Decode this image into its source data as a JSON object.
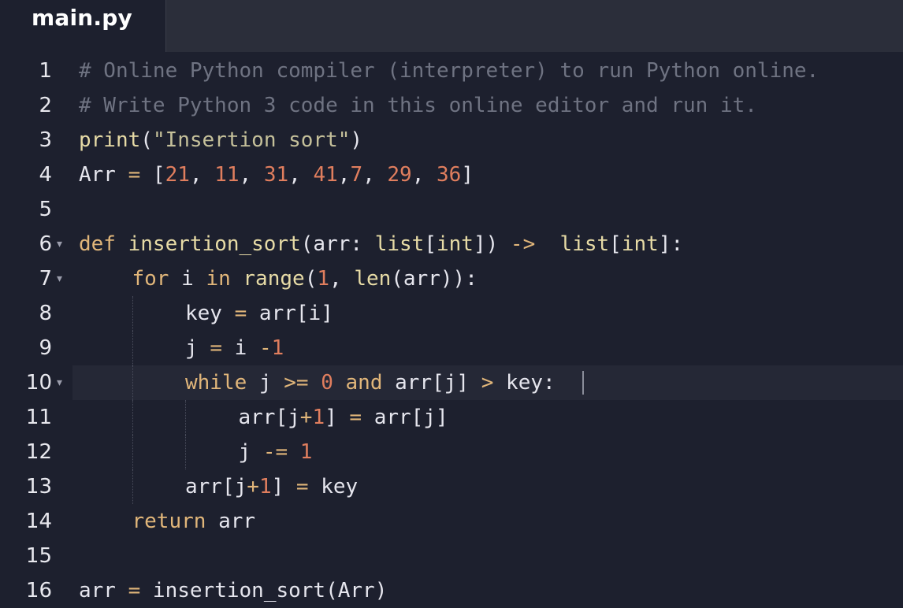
{
  "tab": {
    "label": "main.py"
  },
  "colors": {
    "background": "#1d202e",
    "tabbar": "#2b2e3a",
    "comment": "#6f7382",
    "keyword": "#e1b67a",
    "function": "#e7dba6",
    "string": "#c5c09a",
    "number": "#e07e5e",
    "text": "#e6e6ee"
  },
  "lines": [
    {
      "n": "1",
      "fold": false,
      "active": false,
      "indent": 0,
      "tokens": [
        {
          "t": "# Online Python compiler (interpreter) to run Python online.",
          "c": "comment"
        }
      ]
    },
    {
      "n": "2",
      "fold": false,
      "active": false,
      "indent": 0,
      "tokens": [
        {
          "t": "# Write Python 3 code in this online editor and run it.",
          "c": "comment"
        }
      ]
    },
    {
      "n": "3",
      "fold": false,
      "active": false,
      "indent": 0,
      "tokens": [
        {
          "t": "print",
          "c": "fn"
        },
        {
          "t": "(",
          "c": "plain"
        },
        {
          "t": "\"Insertion sort\"",
          "c": "str"
        },
        {
          "t": ")",
          "c": "plain"
        }
      ]
    },
    {
      "n": "4",
      "fold": false,
      "active": false,
      "indent": 0,
      "tokens": [
        {
          "t": "Arr ",
          "c": "plain"
        },
        {
          "t": "=",
          "c": "op"
        },
        {
          "t": " [",
          "c": "plain"
        },
        {
          "t": "21",
          "c": "num"
        },
        {
          "t": ", ",
          "c": "plain"
        },
        {
          "t": "11",
          "c": "num"
        },
        {
          "t": ", ",
          "c": "plain"
        },
        {
          "t": "31",
          "c": "num"
        },
        {
          "t": ", ",
          "c": "plain"
        },
        {
          "t": "41",
          "c": "num"
        },
        {
          "t": ",",
          "c": "plain"
        },
        {
          "t": "7",
          "c": "num"
        },
        {
          "t": ", ",
          "c": "plain"
        },
        {
          "t": "29",
          "c": "num"
        },
        {
          "t": ", ",
          "c": "plain"
        },
        {
          "t": "36",
          "c": "num"
        },
        {
          "t": "]",
          "c": "plain"
        }
      ]
    },
    {
      "n": "5",
      "fold": false,
      "active": false,
      "indent": 0,
      "tokens": []
    },
    {
      "n": "6",
      "fold": true,
      "active": false,
      "indent": 0,
      "tokens": [
        {
          "t": "def",
          "c": "kw"
        },
        {
          "t": " ",
          "c": "plain"
        },
        {
          "t": "insertion_sort",
          "c": "fn"
        },
        {
          "t": "(arr: ",
          "c": "plain"
        },
        {
          "t": "list",
          "c": "fn"
        },
        {
          "t": "[",
          "c": "plain"
        },
        {
          "t": "int",
          "c": "fn"
        },
        {
          "t": "]) ",
          "c": "plain"
        },
        {
          "t": "->",
          "c": "op"
        },
        {
          "t": "  ",
          "c": "plain"
        },
        {
          "t": "list",
          "c": "fn"
        },
        {
          "t": "[",
          "c": "plain"
        },
        {
          "t": "int",
          "c": "fn"
        },
        {
          "t": "]:",
          "c": "plain"
        }
      ]
    },
    {
      "n": "7",
      "fold": true,
      "active": false,
      "indent": 1,
      "tokens": [
        {
          "t": "for",
          "c": "kw"
        },
        {
          "t": " i ",
          "c": "plain"
        },
        {
          "t": "in",
          "c": "kw"
        },
        {
          "t": " ",
          "c": "plain"
        },
        {
          "t": "range",
          "c": "fn"
        },
        {
          "t": "(",
          "c": "plain"
        },
        {
          "t": "1",
          "c": "num"
        },
        {
          "t": ", ",
          "c": "plain"
        },
        {
          "t": "len",
          "c": "fn"
        },
        {
          "t": "(arr)):",
          "c": "plain"
        }
      ]
    },
    {
      "n": "8",
      "fold": false,
      "active": false,
      "indent": 2,
      "tokens": [
        {
          "t": "key ",
          "c": "plain"
        },
        {
          "t": "=",
          "c": "op"
        },
        {
          "t": " arr[i]",
          "c": "plain"
        }
      ]
    },
    {
      "n": "9",
      "fold": false,
      "active": false,
      "indent": 2,
      "tokens": [
        {
          "t": "j ",
          "c": "plain"
        },
        {
          "t": "=",
          "c": "op"
        },
        {
          "t": " i ",
          "c": "plain"
        },
        {
          "t": "-",
          "c": "op"
        },
        {
          "t": "1",
          "c": "num"
        }
      ]
    },
    {
      "n": "10",
      "fold": true,
      "active": true,
      "indent": 2,
      "tokens": [
        {
          "t": "while",
          "c": "kw"
        },
        {
          "t": " j ",
          "c": "plain"
        },
        {
          "t": ">=",
          "c": "op"
        },
        {
          "t": " ",
          "c": "plain"
        },
        {
          "t": "0",
          "c": "num"
        },
        {
          "t": " ",
          "c": "plain"
        },
        {
          "t": "and",
          "c": "kw"
        },
        {
          "t": " arr[j] ",
          "c": "plain"
        },
        {
          "t": ">",
          "c": "op"
        },
        {
          "t": " key:",
          "c": "plain"
        }
      ]
    },
    {
      "n": "11",
      "fold": false,
      "active": false,
      "indent": 3,
      "tokens": [
        {
          "t": "arr[j",
          "c": "plain"
        },
        {
          "t": "+",
          "c": "op"
        },
        {
          "t": "1",
          "c": "num"
        },
        {
          "t": "] ",
          "c": "plain"
        },
        {
          "t": "=",
          "c": "op"
        },
        {
          "t": " arr[j]",
          "c": "plain"
        }
      ]
    },
    {
      "n": "12",
      "fold": false,
      "active": false,
      "indent": 3,
      "tokens": [
        {
          "t": "j ",
          "c": "plain"
        },
        {
          "t": "-=",
          "c": "op"
        },
        {
          "t": " ",
          "c": "plain"
        },
        {
          "t": "1",
          "c": "num"
        }
      ]
    },
    {
      "n": "13",
      "fold": false,
      "active": false,
      "indent": 2,
      "tokens": [
        {
          "t": "arr[j",
          "c": "plain"
        },
        {
          "t": "+",
          "c": "op"
        },
        {
          "t": "1",
          "c": "num"
        },
        {
          "t": "] ",
          "c": "plain"
        },
        {
          "t": "=",
          "c": "op"
        },
        {
          "t": " key",
          "c": "plain"
        }
      ]
    },
    {
      "n": "14",
      "fold": false,
      "active": false,
      "indent": 1,
      "tokens": [
        {
          "t": "return",
          "c": "kw"
        },
        {
          "t": " arr",
          "c": "plain"
        }
      ]
    },
    {
      "n": "15",
      "fold": false,
      "active": false,
      "indent": 0,
      "tokens": []
    },
    {
      "n": "16",
      "fold": false,
      "active": false,
      "indent": 0,
      "tokens": [
        {
          "t": "arr ",
          "c": "plain"
        },
        {
          "t": "=",
          "c": "op"
        },
        {
          "t": " insertion_sort(Arr)",
          "c": "plain"
        }
      ]
    }
  ]
}
